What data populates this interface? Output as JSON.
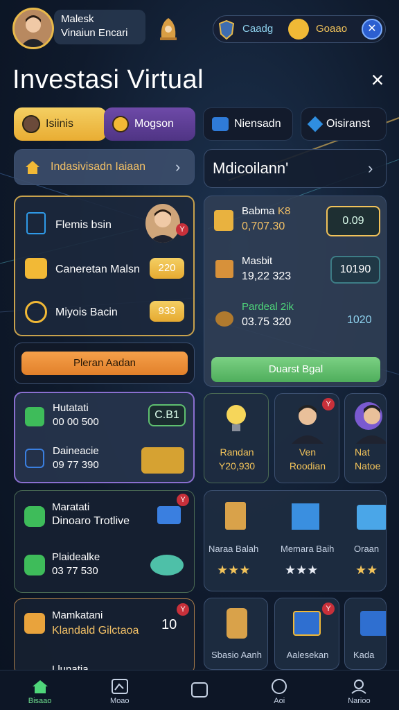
{
  "header": {
    "player_name_line1": "Malesk",
    "player_name_line2": "Vinaiun Encari",
    "currency_1": "Caadg",
    "currency_2": "Goaao"
  },
  "page": {
    "title": "Investasi Virtual",
    "close_icon": "×"
  },
  "tabs": [
    {
      "label": "Isiinis",
      "icon": "avatar"
    },
    {
      "label": "Mogson",
      "icon": "coin"
    },
    {
      "label": "Niensadn",
      "icon": "chest"
    },
    {
      "label": "Oisiranst",
      "icon": "gem"
    }
  ],
  "left_nav": {
    "label": "Indasivisadn Iaiaan",
    "chevron": "›"
  },
  "right_nav": {
    "label": "Mdicoilann'",
    "chevron": "›"
  },
  "left_list": {
    "items": [
      {
        "label": "Flemis bsin"
      },
      {
        "label": "Caneretan Malsn",
        "value": "220"
      },
      {
        "label": "Miyois Bacin",
        "value": "933"
      }
    ],
    "button": "Pleran Aadan"
  },
  "right_stats": {
    "rows": [
      {
        "name": "Babma",
        "name_tag": "K8",
        "value": "0,707.30",
        "badge": "0.09"
      },
      {
        "name": "Masbit",
        "value": "19,22 323",
        "badge": "10190"
      },
      {
        "name": "Pardeal 2ik",
        "value": "03.75 320",
        "badge": "1020"
      }
    ],
    "button": "Duarst Bgal"
  },
  "card_left_1": {
    "line1_label": "Hutatati",
    "line1_value": "00 00 500",
    "badge": "C.B1",
    "line2_label": "Daineacie",
    "line2_value": "09 77 390"
  },
  "card_left_2": {
    "line1_label": "Maratati",
    "line1_sub": "Dinoaro Trotlive",
    "badge": "Y",
    "line2_label": "Plaidealke",
    "line2_value": "03 77 530"
  },
  "card_left_3": {
    "line1": "Mamkatani",
    "line2": "Klandald Gilctaoa",
    "value": "10",
    "badge": "Y",
    "line3": "Llunatia"
  },
  "characters": [
    {
      "name_line1": "Randan",
      "name_line2": "Y20,930",
      "icon": "lightbulb-icon"
    },
    {
      "name_line1": "Ven",
      "name_line2": "Roodian",
      "icon": "person"
    },
    {
      "name_line1": "Nat",
      "name_line2": "Natoe",
      "icon": "person"
    }
  ],
  "items_row_1": [
    {
      "name": "Naraa Balah",
      "stars": "★★★"
    },
    {
      "name": "Memara Baih",
      "stars": "★★★"
    },
    {
      "name": "Oraan",
      "stars": "★★"
    }
  ],
  "items_row_2": [
    {
      "name": "Sbasio Aanh"
    },
    {
      "name": "Aalesekan"
    },
    {
      "name": "Kada"
    }
  ],
  "bottom_nav": [
    {
      "label": "Bisaao",
      "icon": "home-icon"
    },
    {
      "label": "Moao",
      "icon": "chart-icon"
    },
    {
      "label": "",
      "icon": "bag-icon"
    },
    {
      "label": "Aoi",
      "icon": "coin-icon"
    },
    {
      "label": "Narioo",
      "icon": "profile-icon"
    }
  ],
  "colors": {
    "gold": "#e9b23f",
    "purple": "#6e4aa8",
    "green": "#4fae5c",
    "orange": "#f5a04a",
    "bg": "#0f1a2c"
  }
}
